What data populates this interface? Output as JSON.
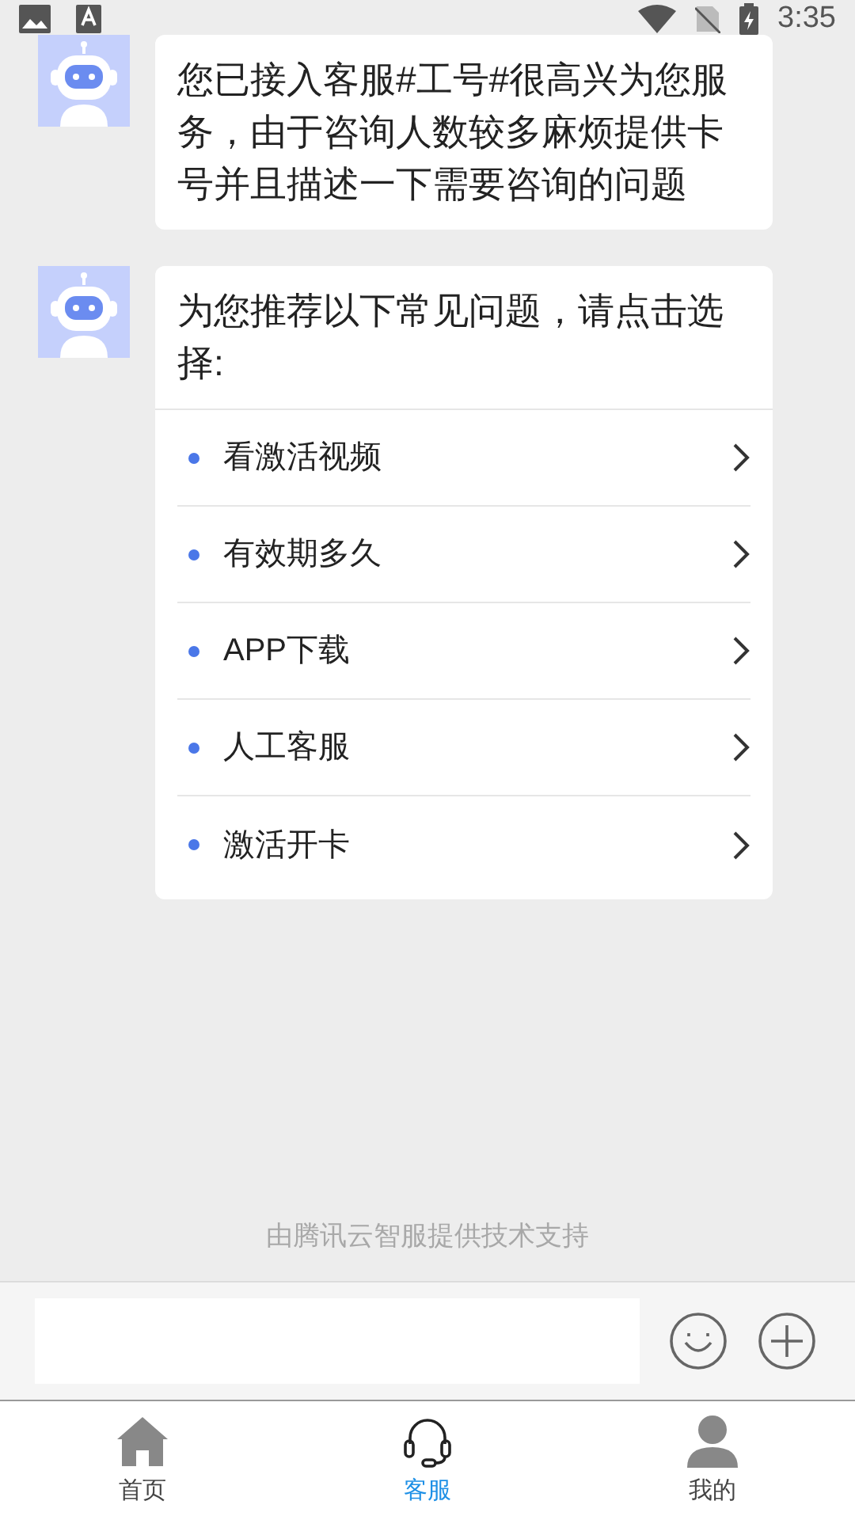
{
  "status_bar": {
    "time": "3:35"
  },
  "messages": [
    {
      "kind": "text",
      "text": "您已接入客服#工号#很高兴为您服务，由于咨询人数较多麻烦提供卡号并且描述一下需要咨询的问题"
    },
    {
      "kind": "menu",
      "text": "为您推荐以下常见问题，请点击选择:",
      "options": [
        "看激活视频",
        "有效期多久",
        "APP下载",
        "人工客服",
        "激活开卡"
      ]
    }
  ],
  "footer_note": "由腾讯云智服提供技术支持",
  "tabs": [
    {
      "label": "首页",
      "kind": "home",
      "selected": false
    },
    {
      "label": "客服",
      "kind": "headset",
      "selected": true
    },
    {
      "label": "我的",
      "kind": "user",
      "selected": false
    }
  ]
}
